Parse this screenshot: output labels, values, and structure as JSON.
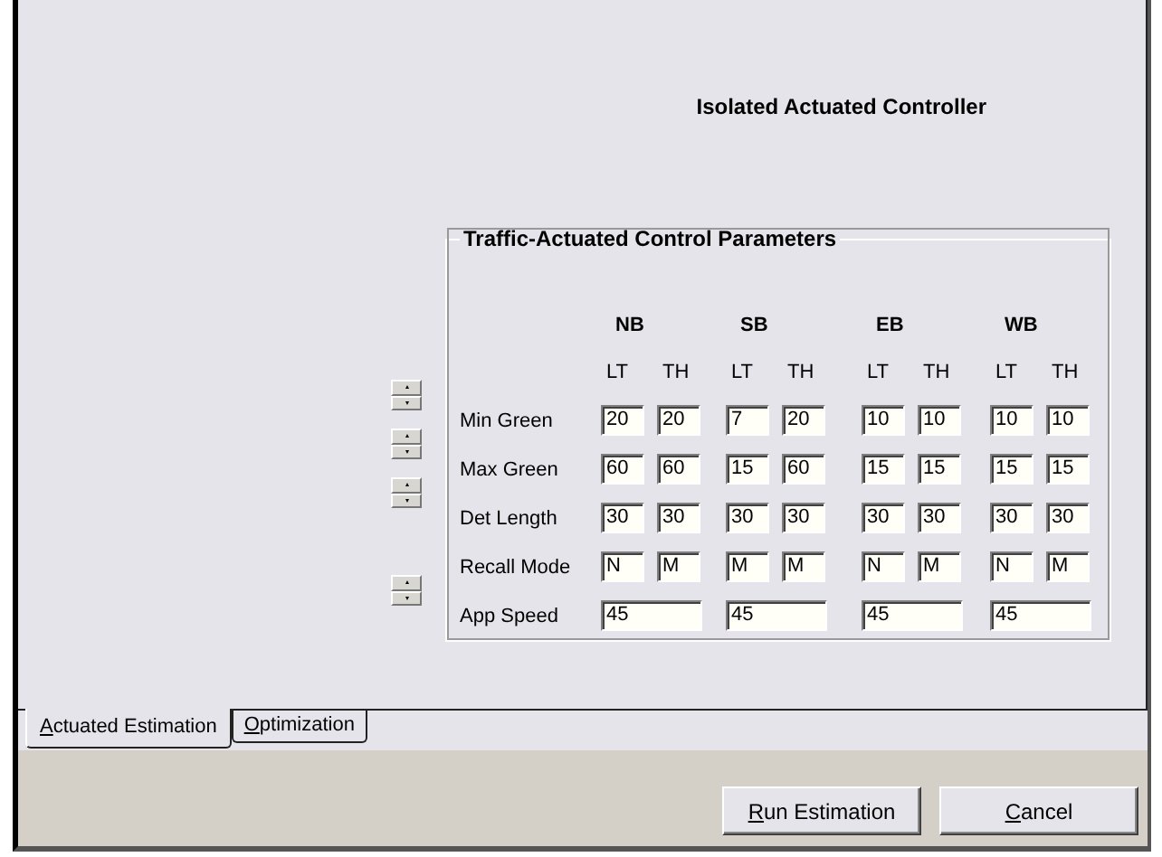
{
  "title": "Isolated Actuated Controller",
  "group": {
    "legend": "Traffic-Actuated Control Parameters",
    "approaches": [
      {
        "name": "NB",
        "movements": [
          "LT",
          "TH"
        ]
      },
      {
        "name": "SB",
        "movements": [
          "LT",
          "TH"
        ]
      },
      {
        "name": "EB",
        "movements": [
          "LT",
          "TH"
        ]
      },
      {
        "name": "WB",
        "movements": [
          "LT",
          "TH"
        ]
      }
    ],
    "rows": [
      {
        "label": "Min Green",
        "spinner": true,
        "kind": "pair",
        "values": [
          "20",
          "20",
          "7",
          "20",
          "10",
          "10",
          "10",
          "10"
        ]
      },
      {
        "label": "Max Green",
        "spinner": true,
        "kind": "pair",
        "values": [
          "60",
          "60",
          "15",
          "60",
          "15",
          "15",
          "15",
          "15"
        ]
      },
      {
        "label": "Det Length",
        "spinner": true,
        "kind": "pair",
        "values": [
          "30",
          "30",
          "30",
          "30",
          "30",
          "30",
          "30",
          "30"
        ]
      },
      {
        "label": "Recall Mode",
        "spinner": false,
        "kind": "pair",
        "values": [
          "N",
          "M",
          "M",
          "M",
          "N",
          "M",
          "N",
          "M"
        ]
      },
      {
        "label": "App Speed",
        "spinner": true,
        "kind": "single",
        "values": [
          "45",
          "45",
          "45",
          "45"
        ]
      }
    ]
  },
  "tabs": [
    {
      "label": "Actuated Estimation",
      "selected": true
    },
    {
      "label": "Optimization",
      "selected": false
    }
  ],
  "buttons": [
    {
      "label": "Run Estimation"
    },
    {
      "label": "Cancel"
    }
  ]
}
